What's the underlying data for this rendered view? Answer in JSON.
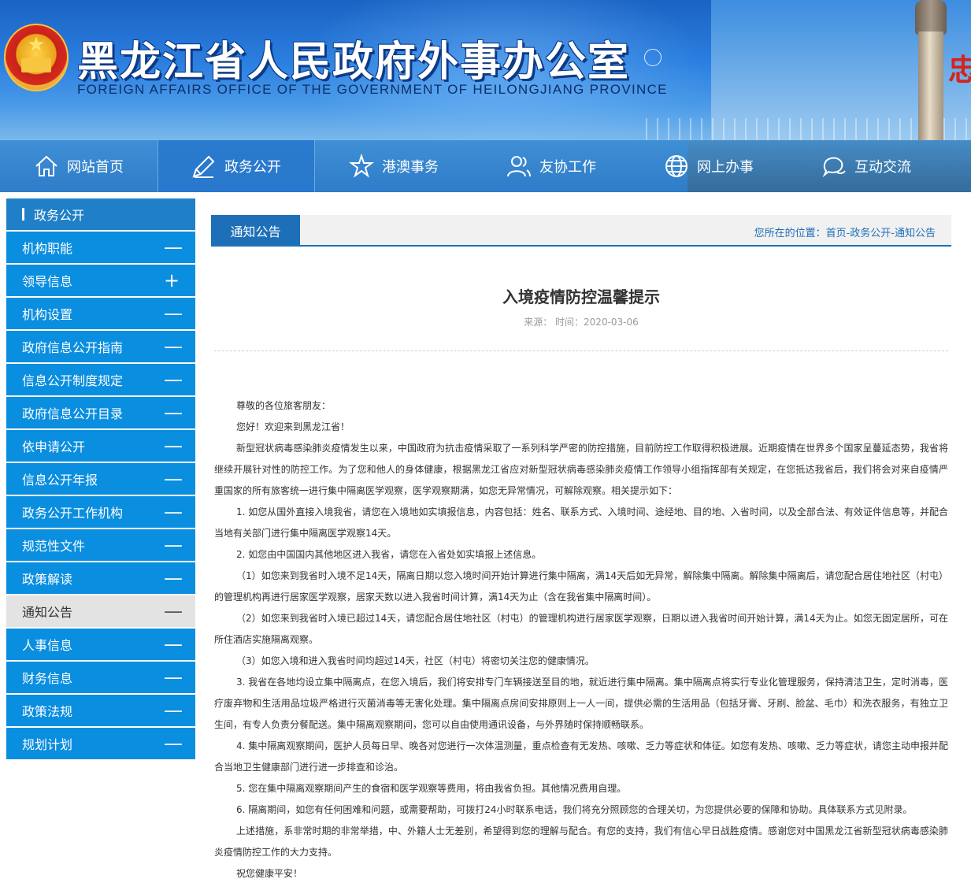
{
  "header": {
    "title": "黑龙江省人民政府外事办公室",
    "subtitle": "FOREIGN AFFAIRS OFFICE OF THE GOVERNMENT OF HEILONGJIANG PROVINCE",
    "edge_char": "忠"
  },
  "nav": {
    "items": [
      {
        "label": "网站首页",
        "icon": "home-icon"
      },
      {
        "label": "政务公开",
        "icon": "pen-icon"
      },
      {
        "label": "港澳事务",
        "icon": "star-icon"
      },
      {
        "label": "友协工作",
        "icon": "people-icon"
      },
      {
        "label": "网上办事",
        "icon": "globe-icon"
      },
      {
        "label": "互动交流",
        "icon": "chat-icon"
      }
    ],
    "active_index": 1
  },
  "sidebar": {
    "heading": "政务公开",
    "items": [
      {
        "label": "机构职能",
        "sign": "—"
      },
      {
        "label": "领导信息",
        "sign": "+"
      },
      {
        "label": "机构设置",
        "sign": "—"
      },
      {
        "label": "政府信息公开指南",
        "sign": "—"
      },
      {
        "label": "信息公开制度规定",
        "sign": "—"
      },
      {
        "label": "政府信息公开目录",
        "sign": "—"
      },
      {
        "label": "依申请公开",
        "sign": "—"
      },
      {
        "label": "信息公开年报",
        "sign": "—"
      },
      {
        "label": "政务公开工作机构",
        "sign": "—"
      },
      {
        "label": "规范性文件",
        "sign": "—"
      },
      {
        "label": "政策解读",
        "sign": "—"
      },
      {
        "label": "通知公告",
        "sign": "—"
      },
      {
        "label": "人事信息",
        "sign": "—"
      },
      {
        "label": "财务信息",
        "sign": "—"
      },
      {
        "label": "政策法规",
        "sign": "—"
      },
      {
        "label": "规划计划",
        "sign": "—"
      }
    ],
    "active_index": 11
  },
  "content": {
    "tab": "通知公告",
    "breadcrumb": "您所在的位置：首页-政务公开-通知公告",
    "title": "入境疫情防控温馨提示",
    "meta": "来源：  时间：2020-03-06",
    "paragraphs": [
      "尊敬的各位旅客朋友：",
      "您好！欢迎来到黑龙江省！",
      "新型冠状病毒感染肺炎疫情发生以来，中国政府为抗击疫情采取了一系列科学严密的防控措施，目前防控工作取得积极进展。近期疫情在世界多个国家呈蔓延态势，我省将继续开展针对性的防控工作。为了您和他人的身体健康，根据黑龙江省应对新型冠状病毒感染肺炎疫情工作领导小组指挥部有关规定，在您抵达我省后，我们将会对来自疫情严重国家的所有旅客统一进行集中隔离医学观察，医学观察期满，如您无异常情况，可解除观察。相关提示如下：",
      "1. 如您从国外直接入境我省，请您在入境地如实填报信息，内容包括：姓名、联系方式、入境时间、途经地、目的地、入省时间，以及全部合法、有效证件信息等，并配合当地有关部门进行集中隔离医学观察14天。",
      "2. 如您由中国国内其他地区进入我省，请您在入省处如实填报上述信息。",
      "（1）如您来到我省时入境不足14天，隔离日期以您入境时间开始计算进行集中隔离，满14天后如无异常，解除集中隔离。解除集中隔离后，请您配合居住地社区（村屯）的管理机构再进行居家医学观察，居家天数以进入我省时间计算，满14天为止（含在我省集中隔离时间）。",
      "（2）如您来到我省时入境已超过14天，请您配合居住地社区（村屯）的管理机构进行居家医学观察，日期以进入我省时间开始计算，满14天为止。如您无固定居所，可在所住酒店实施隔离观察。",
      "（3）如您入境和进入我省时间均超过14天，社区（村屯）将密切关注您的健康情况。",
      "3. 我省在各地均设立集中隔离点，在您入境后，我们将安排专门车辆接送至目的地，就近进行集中隔离。集中隔离点将实行专业化管理服务，保持清洁卫生，定时消毒，医疗废弃物和生活用品垃圾严格进行灭菌消毒等无害化处理。集中隔离点房间安排原则上一人一间，提供必需的生活用品（包括牙膏、牙刷、脸盆、毛巾）和洗衣服务，有独立卫生间，有专人负责分餐配送。集中隔离观察期间，您可以自由使用通讯设备，与外界随时保持顺畅联系。",
      "4. 集中隔离观察期间，医护人员每日早、晚各对您进行一次体温测量，重点检查有无发热、咳嗽、乏力等症状和体征。如您有发热、咳嗽、乏力等症状，请您主动申报并配合当地卫生健康部门进行进一步排查和诊治。",
      "5. 您在集中隔离观察期间产生的食宿和医学观察等费用，将由我省负担。其他情况费用自理。",
      "6. 隔离期间，如您有任何困难和问题，或需要帮助，可拨打24小时联系电话，我们将充分照顾您的合理关切，为您提供必要的保障和协助。具体联系方式见附录。",
      "上述措施，系非常时期的非常举措，中、外籍人士无差别，希望得到您的理解与配合。有您的支持，我们有信心早日战胜疫情。感谢您对中国黑龙江省新型冠状病毒感染肺炎疫情防控工作的大力支持。",
      "祝您健康平安！"
    ]
  }
}
